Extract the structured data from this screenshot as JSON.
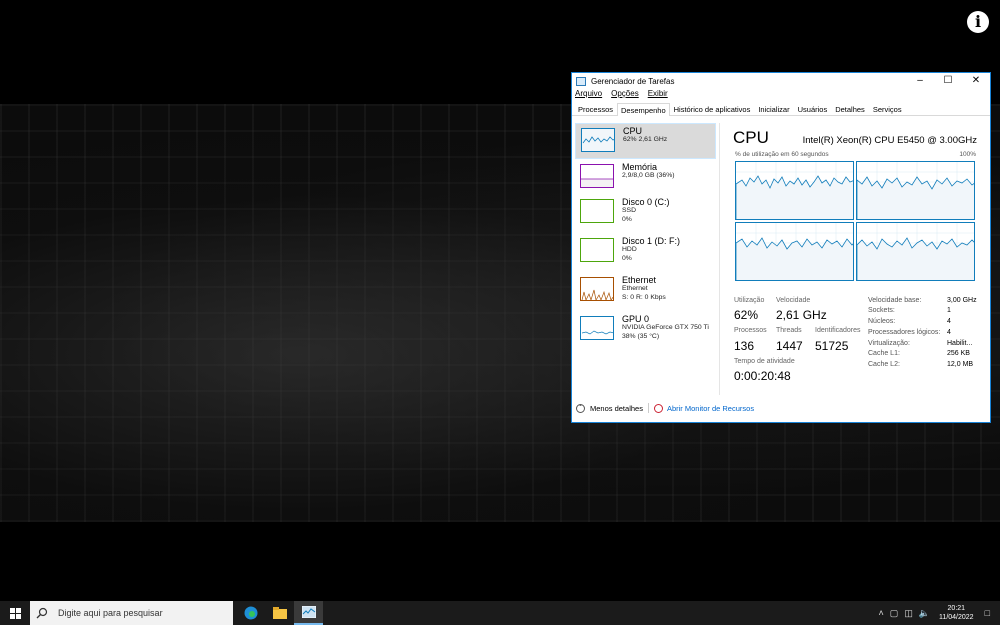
{
  "window": {
    "title": "Gerenciador de Tarefas",
    "menu": [
      "Arquivo",
      "Opções",
      "Exibir"
    ],
    "tabs": [
      "Processos",
      "Desempenho",
      "Histórico de aplicativos",
      "Inicializar",
      "Usuários",
      "Detalhes",
      "Serviços"
    ],
    "active_tab": "Desempenho"
  },
  "resources": [
    {
      "name": "CPU",
      "sub1": "62% 2,61 GHz",
      "sub2": "",
      "sub3": "",
      "color": "#117dbb",
      "selected": true
    },
    {
      "name": "Memória",
      "sub1": "2,9/8,0 GB (36%)",
      "sub2": "",
      "sub3": "",
      "color": "#8b12ae"
    },
    {
      "name": "Disco 0 (C:)",
      "sub1": "SSD",
      "sub2": "0%",
      "sub3": "",
      "color": "#4da60c"
    },
    {
      "name": "Disco 1 (D: F:)",
      "sub1": "HDD",
      "sub2": "0%",
      "sub3": "",
      "color": "#4da60c"
    },
    {
      "name": "Ethernet",
      "sub1": "Ethernet",
      "sub2": "S: 0 R: 0 Kbps",
      "sub3": "",
      "color": "#a74f01"
    },
    {
      "name": "GPU 0",
      "sub1": "NVIDIA GeForce GTX 750 Ti",
      "sub2": "38% (35 °C)",
      "sub3": "",
      "color": "#117dbb"
    }
  ],
  "detail": {
    "title": "CPU",
    "model": "Intel(R) Xeon(R) CPU E5450 @ 3.00GHz",
    "graph_label": "% de utilização em 60 segundos",
    "graph_max": "100%",
    "stats": {
      "utilizacao_label": "Utilização",
      "utilizacao": "62%",
      "velocidade_label": "Velocidade",
      "velocidade": "2,61 GHz",
      "processos_label": "Processos",
      "processos": "136",
      "threads_label": "Threads",
      "threads": "1447",
      "identificadores_label": "Identificadores",
      "identificadores": "51725",
      "tempo_label": "Tempo de atividade",
      "tempo": "0:00:20:48"
    },
    "specs": [
      {
        "k": "Velocidade base:",
        "v": "3,00 GHz"
      },
      {
        "k": "Sockets:",
        "v": "1"
      },
      {
        "k": "Núcleos:",
        "v": "4"
      },
      {
        "k": "Processadores lógicos:",
        "v": "4"
      },
      {
        "k": "Virtualização:",
        "v": "Habilit..."
      },
      {
        "k": "Cache L1:",
        "v": "256 KB"
      },
      {
        "k": "Cache L2:",
        "v": "12,0 MB"
      }
    ],
    "footer_less": "Menos detalhes",
    "footer_monitor": "Abrir Monitor de Recursos"
  },
  "taskbar": {
    "search_placeholder": "Digite aqui para pesquisar",
    "time": "20:21",
    "date": "11/04/2022"
  },
  "colors": {
    "accent": "#117dbb",
    "graph_fill": "#f1f6fa"
  }
}
